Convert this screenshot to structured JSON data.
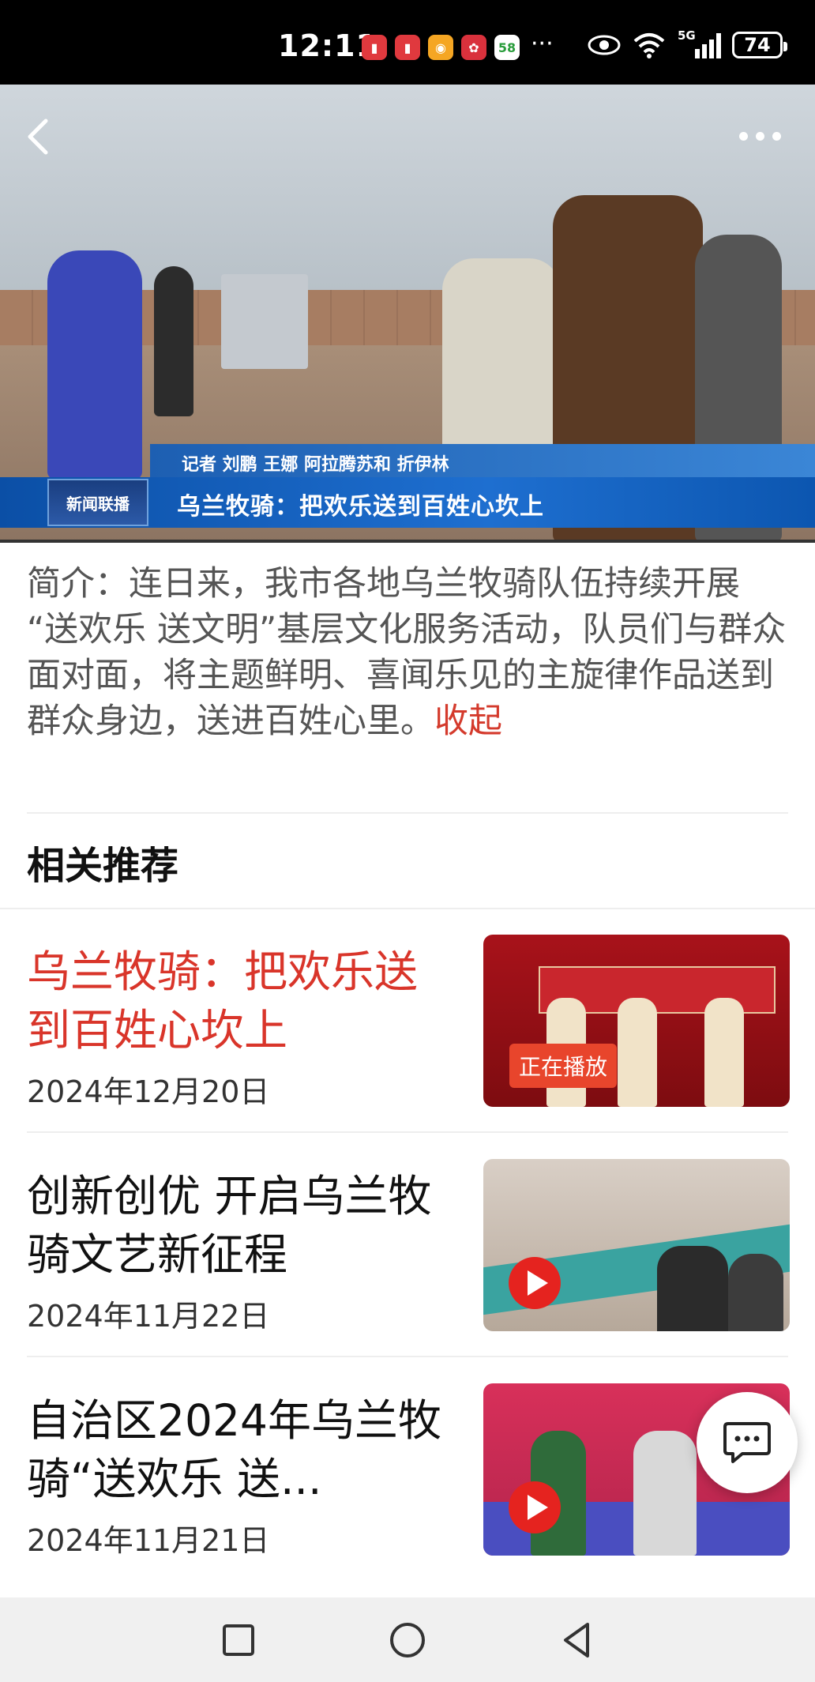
{
  "status_bar": {
    "time": "12:11",
    "battery": "74",
    "network": "5G",
    "more": "···",
    "app_icons": [
      {
        "name": "app-icon-red-book",
        "color": "#e0393e"
      },
      {
        "name": "app-icon-red-book-2",
        "color": "#e0393e"
      },
      {
        "name": "weibo-icon",
        "color": "#f5a623"
      },
      {
        "name": "huawei-icon",
        "color": "#d9313c"
      },
      {
        "name": "app-58-icon",
        "color": "#ffffff"
      }
    ]
  },
  "video": {
    "reporters": "记者 刘鹏 王娜 阿拉腾苏和 折伊林",
    "program_logo": "新闻联播",
    "headline": "乌兰牧骑：把欢乐送到百姓心坎上"
  },
  "intro": {
    "text": "简介：连日来，我市各地乌兰牧骑队伍持续开展 “送欢乐 送文明”基层文化服务活动，队员们与群众面对面，将主题鲜明、喜闻乐见的主旋律作品送到群众身边，送进百姓心里。",
    "collapse_label": "收起"
  },
  "related": {
    "title": "相关推荐",
    "items": [
      {
        "title": "乌兰牧骑：把欢乐送到百姓心坎上",
        "date": "2024年12月20日",
        "badge": "正在播放",
        "active": true
      },
      {
        "title": "创新创优  开启乌兰牧骑文艺新征程",
        "date": "2024年11月22日",
        "active": false
      },
      {
        "title": "自治区2024年乌兰牧骑“送欢乐  送...",
        "date": "2024年11月21日",
        "active": false
      }
    ]
  },
  "colors": {
    "accent": "#d9352a",
    "news_blue": "#1e6fd0"
  }
}
